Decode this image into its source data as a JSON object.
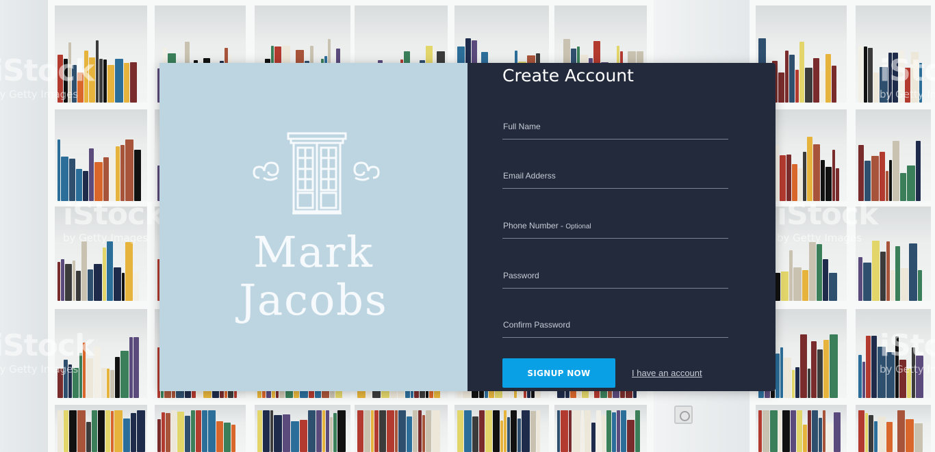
{
  "brand": {
    "line1": "Mark",
    "line2": "Jacobs"
  },
  "form": {
    "title": "Create Account",
    "fields": [
      {
        "label": "Full Name",
        "optional_note": ""
      },
      {
        "label": "Email Adderss",
        "optional_note": ""
      },
      {
        "label": "Phone Number - ",
        "optional_note": "Optional"
      },
      {
        "label": "Password",
        "optional_note": ""
      },
      {
        "label": "Confirm Password",
        "optional_note": ""
      }
    ],
    "submit_label": "SIGNUP NOW",
    "login_link": "I have an account"
  },
  "background": {
    "watermark_brand": "iStock",
    "watermark_sub": "by Getty Images"
  },
  "colors": {
    "card_left_bg": "#bdd5e1",
    "card_right_bg": "#222a3b",
    "button_bg": "#0aa0e6",
    "field_line": "#7c8495"
  }
}
